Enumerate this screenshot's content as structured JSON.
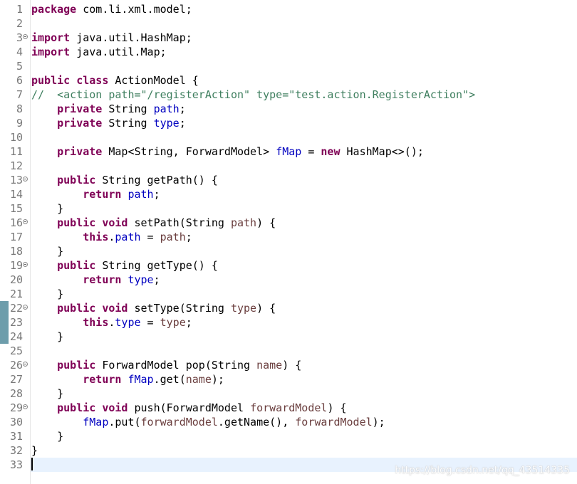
{
  "editor": {
    "language": "java",
    "colors": {
      "keyword": "#7f0055",
      "field": "#0000c0",
      "parameter": "#6a3e3e",
      "comment": "#3f7f5f",
      "line_number": "#787878",
      "current_line": "#e8f2fe",
      "change_marker": "#6d9dab"
    },
    "lines": [
      {
        "n": "1",
        "fold": false,
        "changed": false,
        "tokens": [
          [
            "kw",
            "package"
          ],
          [
            "plain",
            " com.li.xml.model;"
          ]
        ]
      },
      {
        "n": "2",
        "fold": false,
        "changed": false,
        "tokens": []
      },
      {
        "n": "3",
        "fold": true,
        "changed": false,
        "tokens": [
          [
            "kw",
            "import"
          ],
          [
            "plain",
            " java.util.HashMap;"
          ]
        ]
      },
      {
        "n": "4",
        "fold": false,
        "changed": false,
        "tokens": [
          [
            "kw",
            "import"
          ],
          [
            "plain",
            " java.util.Map;"
          ]
        ]
      },
      {
        "n": "5",
        "fold": false,
        "changed": false,
        "tokens": []
      },
      {
        "n": "6",
        "fold": false,
        "changed": false,
        "tokens": [
          [
            "kw",
            "public"
          ],
          [
            "plain",
            " "
          ],
          [
            "kw",
            "class"
          ],
          [
            "plain",
            " ActionModel {"
          ]
        ]
      },
      {
        "n": "7",
        "fold": false,
        "changed": false,
        "tokens": [
          [
            "comment",
            "//  <action path=\"/registerAction\" type=\"test.action.RegisterAction\">"
          ]
        ]
      },
      {
        "n": "8",
        "fold": false,
        "changed": false,
        "tokens": [
          [
            "plain",
            "    "
          ],
          [
            "kw",
            "private"
          ],
          [
            "plain",
            " String "
          ],
          [
            "field",
            "path"
          ],
          [
            "plain",
            ";"
          ]
        ]
      },
      {
        "n": "9",
        "fold": false,
        "changed": false,
        "tokens": [
          [
            "plain",
            "    "
          ],
          [
            "kw",
            "private"
          ],
          [
            "plain",
            " String "
          ],
          [
            "field",
            "type"
          ],
          [
            "plain",
            ";"
          ]
        ]
      },
      {
        "n": "10",
        "fold": false,
        "changed": false,
        "tokens": []
      },
      {
        "n": "11",
        "fold": false,
        "changed": false,
        "tokens": [
          [
            "plain",
            "    "
          ],
          [
            "kw",
            "private"
          ],
          [
            "plain",
            " Map<String, ForwardModel> "
          ],
          [
            "field",
            "fMap"
          ],
          [
            "plain",
            " = "
          ],
          [
            "kw",
            "new"
          ],
          [
            "plain",
            " HashMap<>();"
          ]
        ]
      },
      {
        "n": "12",
        "fold": false,
        "changed": false,
        "tokens": []
      },
      {
        "n": "13",
        "fold": true,
        "changed": false,
        "tokens": [
          [
            "plain",
            "    "
          ],
          [
            "kw",
            "public"
          ],
          [
            "plain",
            " String getPath() {"
          ]
        ]
      },
      {
        "n": "14",
        "fold": false,
        "changed": false,
        "tokens": [
          [
            "plain",
            "        "
          ],
          [
            "kw",
            "return"
          ],
          [
            "plain",
            " "
          ],
          [
            "field",
            "path"
          ],
          [
            "plain",
            ";"
          ]
        ]
      },
      {
        "n": "15",
        "fold": false,
        "changed": false,
        "tokens": [
          [
            "plain",
            "    }"
          ]
        ]
      },
      {
        "n": "16",
        "fold": true,
        "changed": false,
        "tokens": [
          [
            "plain",
            "    "
          ],
          [
            "kw",
            "public"
          ],
          [
            "plain",
            " "
          ],
          [
            "kw",
            "void"
          ],
          [
            "plain",
            " setPath(String "
          ],
          [
            "param",
            "path"
          ],
          [
            "plain",
            ") {"
          ]
        ]
      },
      {
        "n": "17",
        "fold": false,
        "changed": false,
        "tokens": [
          [
            "plain",
            "        "
          ],
          [
            "kw",
            "this"
          ],
          [
            "plain",
            "."
          ],
          [
            "field",
            "path"
          ],
          [
            "plain",
            " = "
          ],
          [
            "param",
            "path"
          ],
          [
            "plain",
            ";"
          ]
        ]
      },
      {
        "n": "18",
        "fold": false,
        "changed": false,
        "tokens": [
          [
            "plain",
            "    }"
          ]
        ]
      },
      {
        "n": "19",
        "fold": true,
        "changed": false,
        "tokens": [
          [
            "plain",
            "    "
          ],
          [
            "kw",
            "public"
          ],
          [
            "plain",
            " String getType() {"
          ]
        ]
      },
      {
        "n": "20",
        "fold": false,
        "changed": false,
        "tokens": [
          [
            "plain",
            "        "
          ],
          [
            "kw",
            "return"
          ],
          [
            "plain",
            " "
          ],
          [
            "field",
            "type"
          ],
          [
            "plain",
            ";"
          ]
        ]
      },
      {
        "n": "21",
        "fold": false,
        "changed": false,
        "tokens": [
          [
            "plain",
            "    }"
          ]
        ]
      },
      {
        "n": "22",
        "fold": true,
        "changed": true,
        "tokens": [
          [
            "plain",
            "    "
          ],
          [
            "kw",
            "public"
          ],
          [
            "plain",
            " "
          ],
          [
            "kw",
            "void"
          ],
          [
            "plain",
            " setType(String "
          ],
          [
            "param",
            "type"
          ],
          [
            "plain",
            ") {"
          ]
        ]
      },
      {
        "n": "23",
        "fold": false,
        "changed": true,
        "tokens": [
          [
            "plain",
            "        "
          ],
          [
            "kw",
            "this"
          ],
          [
            "plain",
            "."
          ],
          [
            "field",
            "type"
          ],
          [
            "plain",
            " = "
          ],
          [
            "param",
            "type"
          ],
          [
            "plain",
            ";"
          ]
        ]
      },
      {
        "n": "24",
        "fold": false,
        "changed": true,
        "tokens": [
          [
            "plain",
            "    }"
          ]
        ]
      },
      {
        "n": "25",
        "fold": false,
        "changed": false,
        "tokens": []
      },
      {
        "n": "26",
        "fold": true,
        "changed": false,
        "tokens": [
          [
            "plain",
            "    "
          ],
          [
            "kw",
            "public"
          ],
          [
            "plain",
            " ForwardModel pop(String "
          ],
          [
            "param",
            "name"
          ],
          [
            "plain",
            ") {"
          ]
        ]
      },
      {
        "n": "27",
        "fold": false,
        "changed": false,
        "tokens": [
          [
            "plain",
            "        "
          ],
          [
            "kw",
            "return"
          ],
          [
            "plain",
            " "
          ],
          [
            "field",
            "fMap"
          ],
          [
            "plain",
            ".get("
          ],
          [
            "param",
            "name"
          ],
          [
            "plain",
            ");"
          ]
        ]
      },
      {
        "n": "28",
        "fold": false,
        "changed": false,
        "tokens": [
          [
            "plain",
            "    }"
          ]
        ]
      },
      {
        "n": "29",
        "fold": true,
        "changed": false,
        "tokens": [
          [
            "plain",
            "    "
          ],
          [
            "kw",
            "public"
          ],
          [
            "plain",
            " "
          ],
          [
            "kw",
            "void"
          ],
          [
            "plain",
            " push(ForwardModel "
          ],
          [
            "param",
            "forwardModel"
          ],
          [
            "plain",
            ") {"
          ]
        ]
      },
      {
        "n": "30",
        "fold": false,
        "changed": false,
        "tokens": [
          [
            "plain",
            "        "
          ],
          [
            "field",
            "fMap"
          ],
          [
            "plain",
            ".put("
          ],
          [
            "param",
            "forwardModel"
          ],
          [
            "plain",
            ".getName(), "
          ],
          [
            "param",
            "forwardModel"
          ],
          [
            "plain",
            ");"
          ]
        ]
      },
      {
        "n": "31",
        "fold": false,
        "changed": false,
        "tokens": [
          [
            "plain",
            "    }"
          ]
        ]
      },
      {
        "n": "32",
        "fold": false,
        "changed": false,
        "tokens": [
          [
            "plain",
            "}"
          ]
        ]
      },
      {
        "n": "33",
        "fold": false,
        "changed": false,
        "current": true,
        "tokens": []
      }
    ]
  },
  "watermark": "https://blog.csdn.net/qq_43514335"
}
